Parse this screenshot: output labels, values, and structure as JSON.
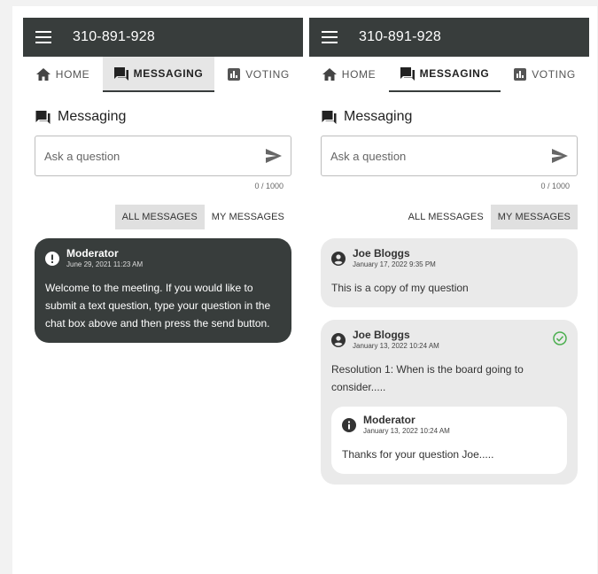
{
  "app": {
    "phone": "310-891-928"
  },
  "tabs": {
    "home": "HOME",
    "messaging": "MESSAGING",
    "voting": "VOTING"
  },
  "section": {
    "title": "Messaging"
  },
  "input": {
    "placeholder": "Ask a question",
    "counter": "0 / 1000"
  },
  "filters": {
    "all": "ALL MESSAGES",
    "mine": "MY MESSAGES"
  },
  "left": {
    "messages": [
      {
        "author": "Moderator",
        "date": "June 29, 2021 11:23 AM",
        "body": "Welcome to the meeting. If you would like to submit a text question, type your question in the chat box above and then press the send button."
      }
    ]
  },
  "right": {
    "messages": [
      {
        "author": "Joe Bloggs",
        "date": "January 17, 2022 9:35 PM",
        "body": "This is a copy of my question"
      },
      {
        "author": "Joe Bloggs",
        "date": "January 13, 2022 10:24 AM",
        "body": "Resolution 1: When is the board going to consider.....",
        "reply": {
          "author": "Moderator",
          "date": "January 13, 2022 10:24 AM",
          "body": "Thanks for your question Joe....."
        }
      }
    ]
  },
  "colors": {
    "appbar": "#383d3c",
    "answered_check": "#4caf50",
    "bubble_light": "#eaeaea"
  }
}
